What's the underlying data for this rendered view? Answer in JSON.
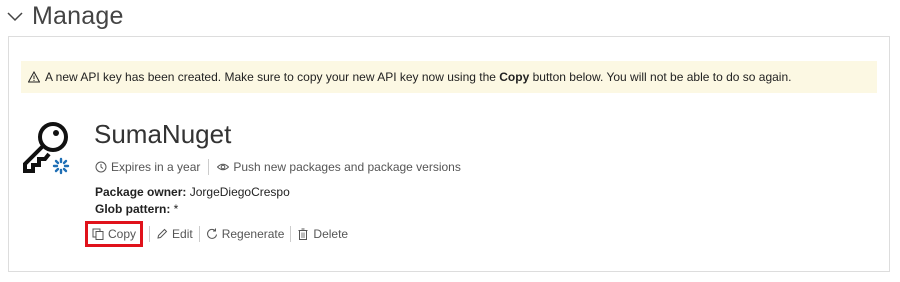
{
  "section": {
    "title": "Manage",
    "chevron_icon": "chevron-down-icon"
  },
  "alert": {
    "icon": "warning-icon",
    "text_before": "A new API key has been created. Make sure to copy your new API key now using the ",
    "text_bold": "Copy",
    "text_after": " button below. You will not be able to do so again.",
    "background": "#fcf8e3"
  },
  "api_key": {
    "icon": "key-icon",
    "name": "SumaNuget",
    "expires": "Expires in a year",
    "scope": "Push new packages and package versions",
    "owner_label": "Package owner:",
    "owner_value": "JorgeDiegoCrespo",
    "glob_label": "Glob pattern:",
    "glob_value": "*"
  },
  "actions": {
    "copy": "Copy",
    "edit": "Edit",
    "regenerate": "Regenerate",
    "delete": "Delete",
    "highlight_color": "#e0121b"
  }
}
